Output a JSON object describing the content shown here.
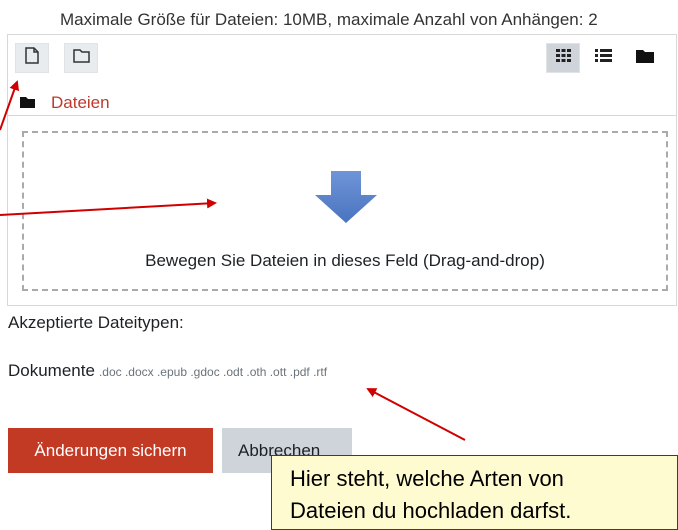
{
  "filepicker": {
    "limits_text": "Maximale Größe für Dateien: 10MB, maximale Anzahl von Anhängen: 2",
    "toolbar": {
      "add_file_icon": "file-icon",
      "create_folder_icon": "folder-outline-icon",
      "view_icons_icon": "grid-icon",
      "view_list_icon": "list-icon",
      "view_tree_icon": "folder-solid-icon"
    },
    "path_label": "Dateien",
    "dropzone_text": "Bewegen Sie Dateien in dieses Feld (Drag-and-drop)",
    "accepted_label": "Akzeptierte Dateitypen:",
    "doc_group_label": "Dokumente",
    "doc_extensions": ".doc .docx .epub .gdoc .odt .oth .ott .pdf .rtf"
  },
  "actions": {
    "save_label": "Änderungen sichern",
    "cancel_label": "Abbrechen"
  },
  "annotation": {
    "line1": "Hier steht, welche Arten von",
    "line2": "Dateien du hochladen darfst."
  },
  "colors": {
    "accent_red": "#c23a24",
    "path_red": "#c0392b",
    "arrow_blue": "#5b83c9",
    "callout_bg": "#fdfbcf",
    "annotation_red": "#d00000"
  }
}
